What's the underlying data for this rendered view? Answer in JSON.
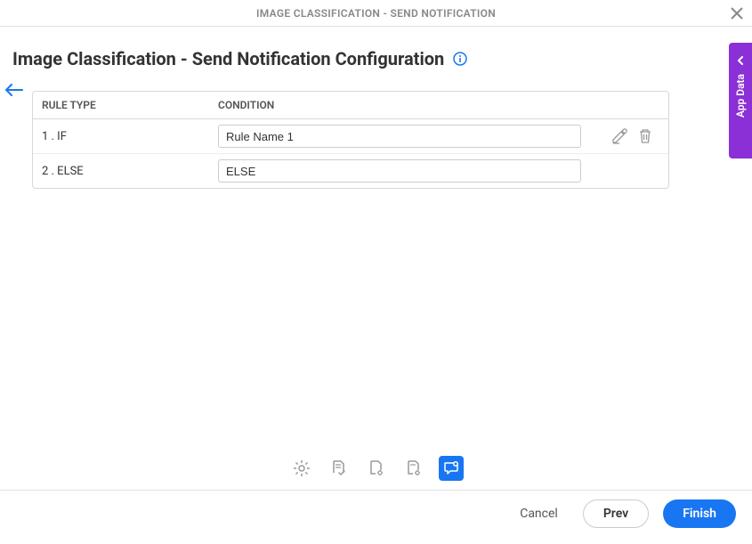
{
  "titlebar": {
    "text": "IMAGE CLASSIFICATION - SEND NOTIFICATION"
  },
  "header": {
    "title": "Image Classification - Send Notification Configuration"
  },
  "table": {
    "headers": {
      "ruletype": "RULE TYPE",
      "condition": "CONDITION"
    },
    "rows": [
      {
        "label": "1 . IF",
        "value": "Rule Name 1",
        "editable": true
      },
      {
        "label": "2 . ELSE",
        "value": "ELSE",
        "editable": false
      }
    ]
  },
  "side": {
    "label": "App Data"
  },
  "footer": {
    "cancel": "Cancel",
    "prev": "Prev",
    "finish": "Finish"
  }
}
